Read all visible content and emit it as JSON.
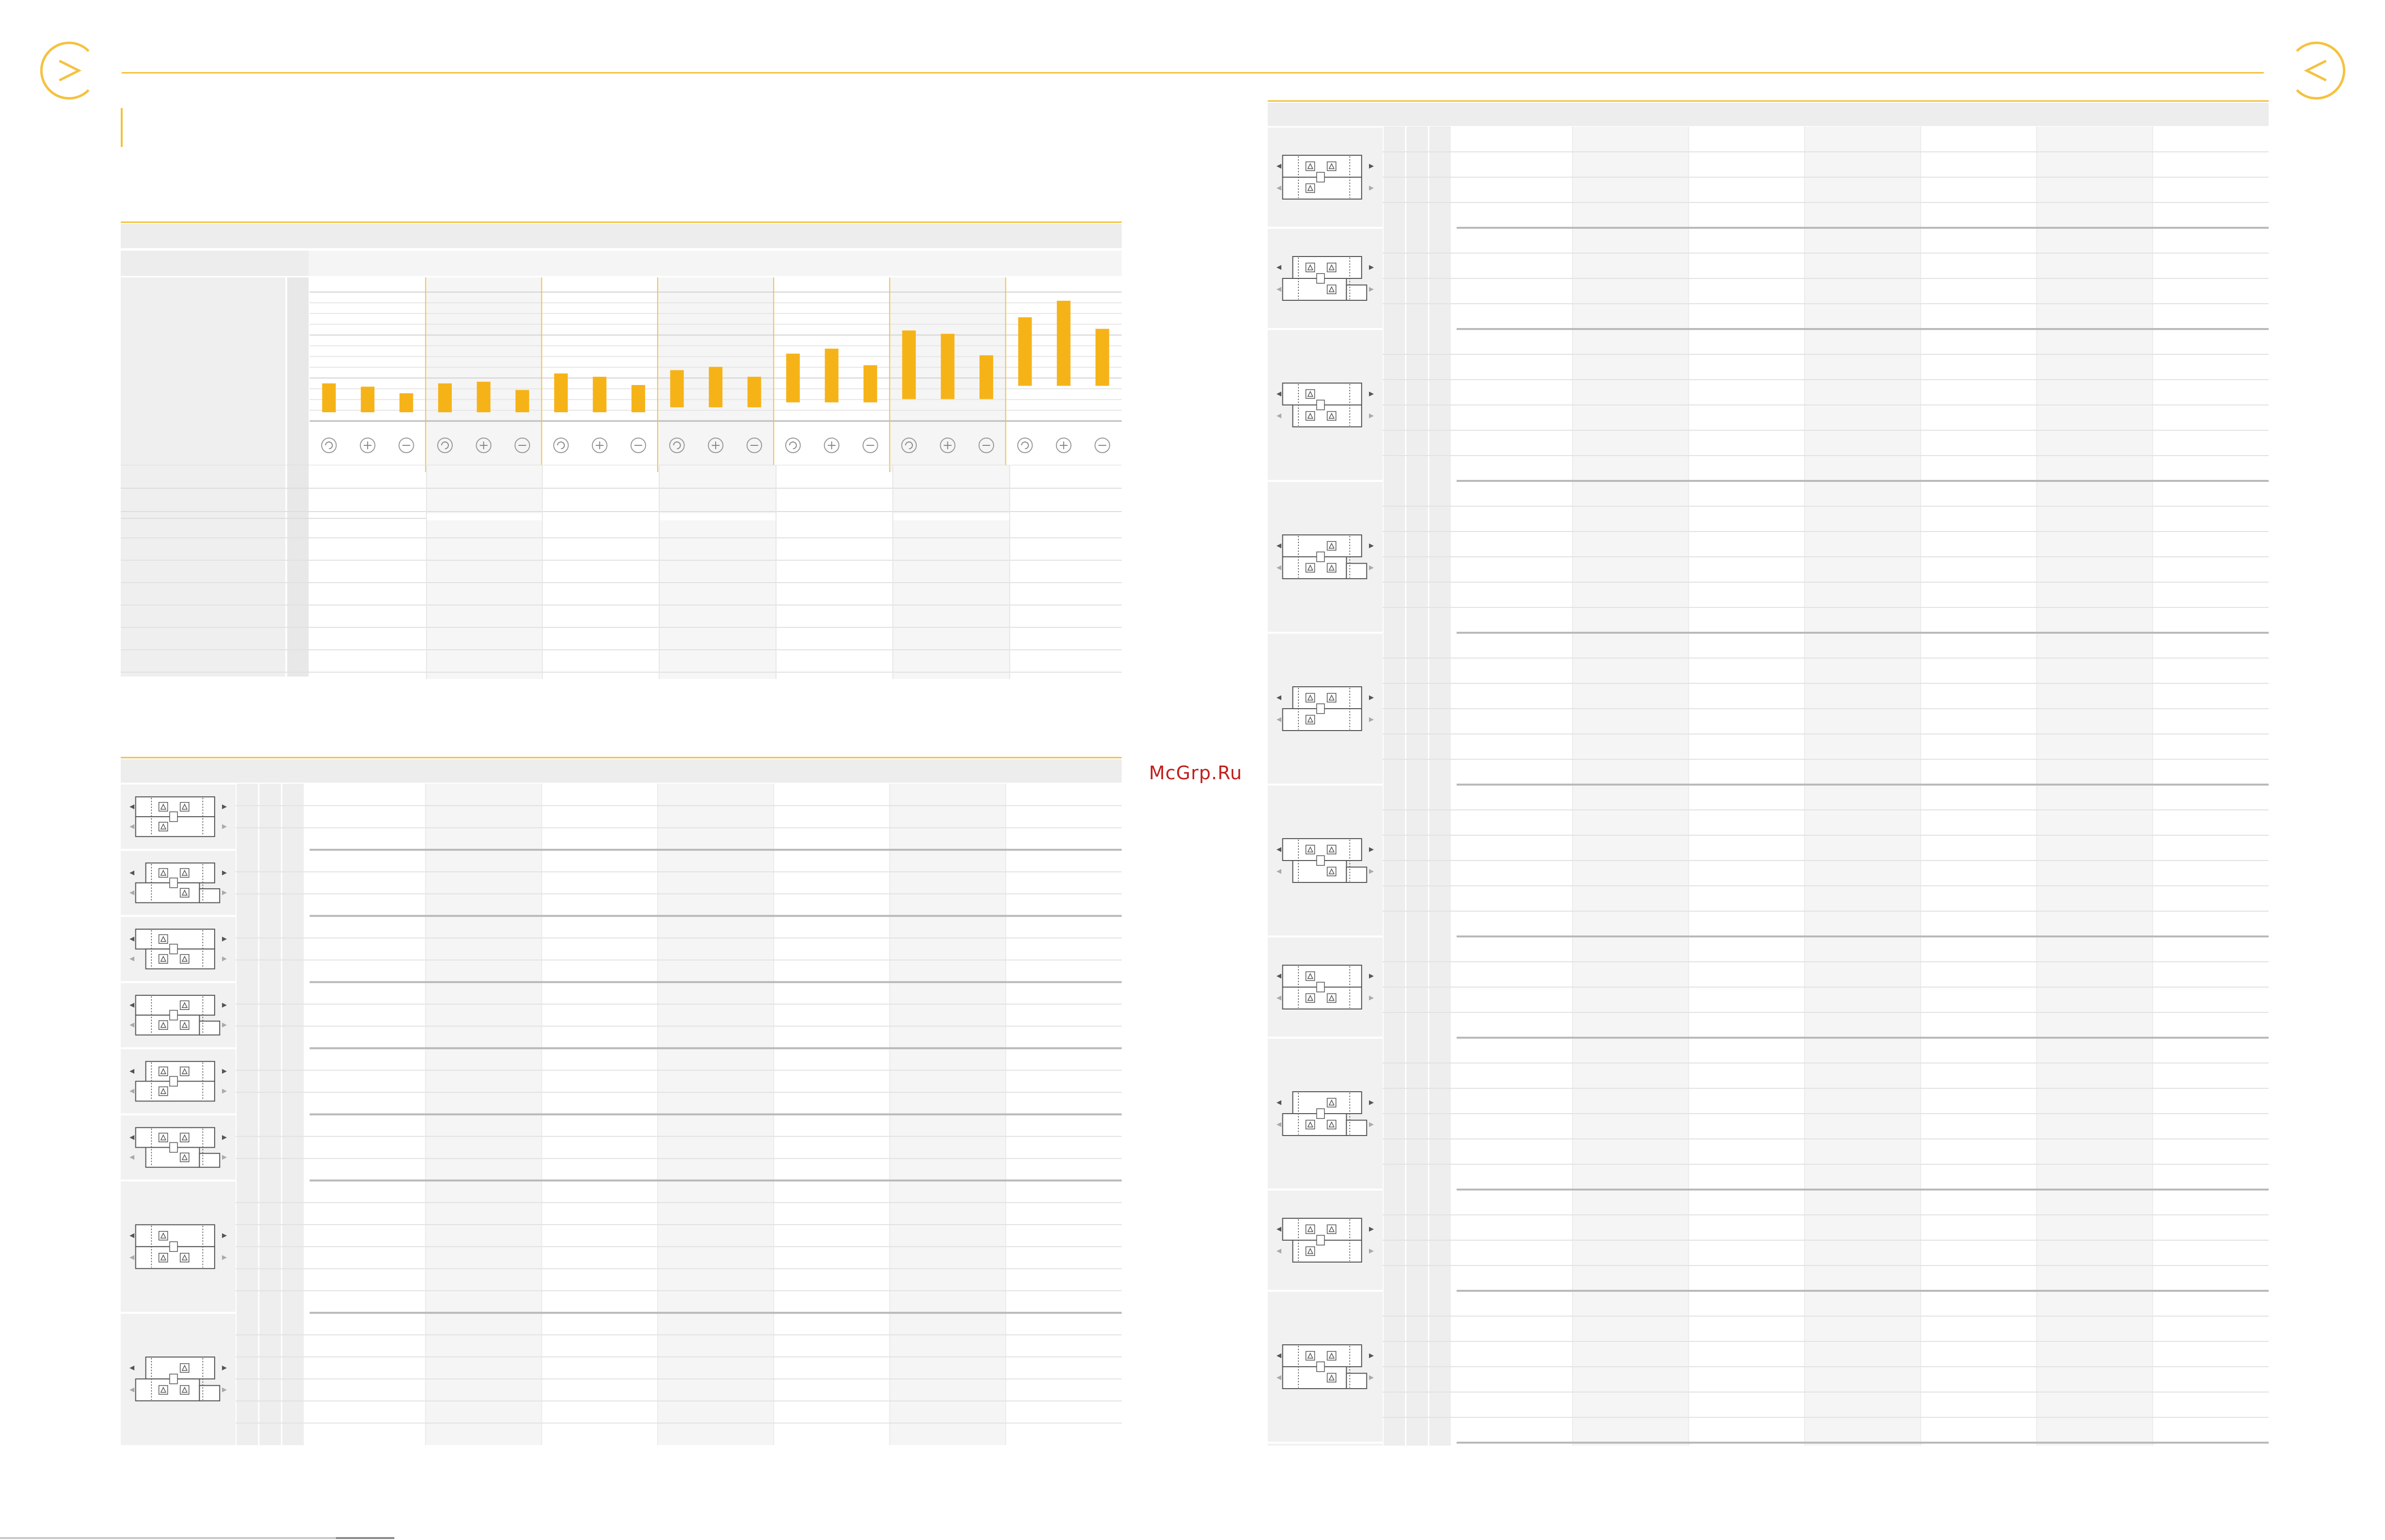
{
  "watermark": "McGrp.Ru",
  "chart_data": {
    "type": "bar",
    "title": "",
    "xlabel": "",
    "ylabel": "",
    "groups": 7,
    "bars_per_group": 3,
    "bar_color": "#f6b318",
    "values": [
      {
        "low": 0.0,
        "high": 0.55
      },
      {
        "low": 0.0,
        "high": 0.45
      },
      {
        "low": 0.0,
        "high": 0.25
      },
      {
        "low": 0.0,
        "high": 0.55
      },
      {
        "low": 0.0,
        "high": 0.6
      },
      {
        "low": 0.0,
        "high": 0.35
      },
      {
        "low": 0.0,
        "high": 0.85
      },
      {
        "low": 0.0,
        "high": 0.75
      },
      {
        "low": 0.0,
        "high": 0.5
      },
      {
        "low": 0.15,
        "high": 0.95
      },
      {
        "low": 0.15,
        "high": 1.05
      },
      {
        "low": 0.15,
        "high": 0.75
      },
      {
        "low": 0.3,
        "high": 1.45
      },
      {
        "low": 0.3,
        "high": 1.6
      },
      {
        "low": 0.3,
        "high": 1.1
      },
      {
        "low": 0.4,
        "high": 2.15
      },
      {
        "low": 0.4,
        "high": 2.05
      },
      {
        "low": 0.4,
        "high": 1.4
      },
      {
        "low": 0.8,
        "high": 2.55
      },
      {
        "low": 0.8,
        "high": 3.05
      },
      {
        "low": 0.8,
        "high": 2.2
      }
    ],
    "ylim": [
      0,
      3.2
    ],
    "grid": true,
    "legend": "none",
    "icon_cycle": [
      "rotate-icon",
      "plus-icon",
      "minus-icon"
    ]
  }
}
